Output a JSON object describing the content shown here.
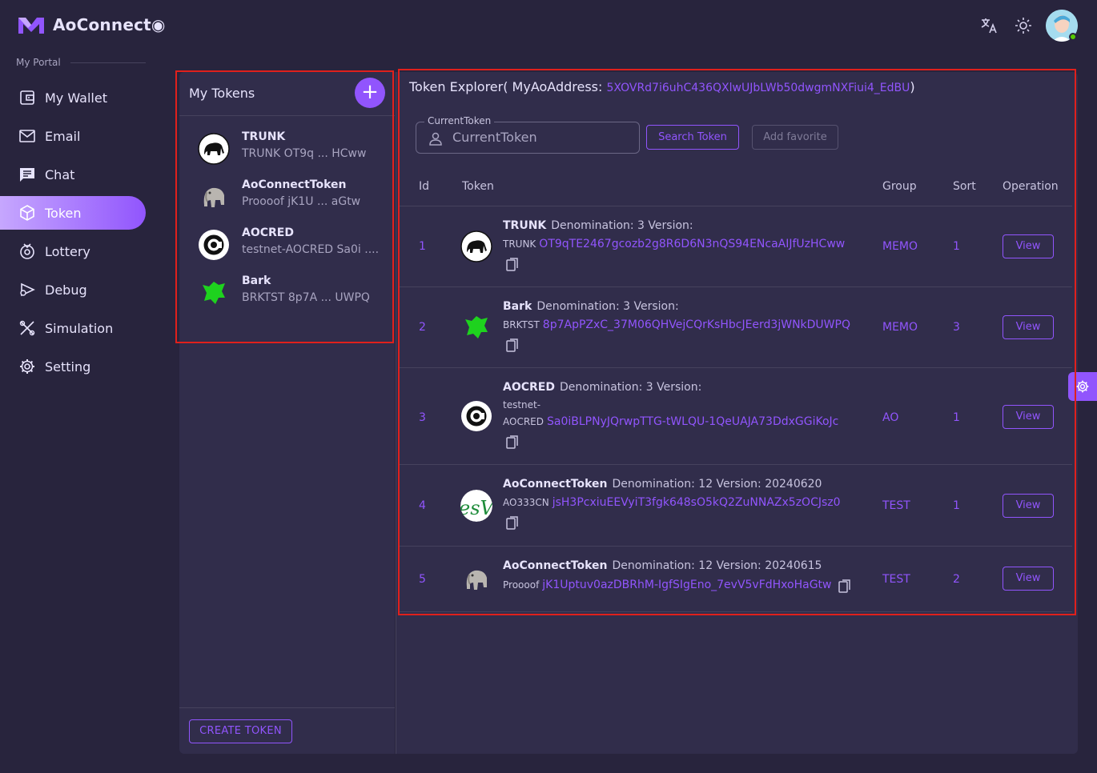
{
  "app": {
    "name": "AoConnect◉"
  },
  "sidebar": {
    "section_label": "My Portal",
    "items": [
      {
        "label": "My Wallet",
        "icon": "wallet-icon"
      },
      {
        "label": "Email",
        "icon": "email-icon"
      },
      {
        "label": "Chat",
        "icon": "chat-icon"
      },
      {
        "label": "Token",
        "icon": "token-icon",
        "active": true
      },
      {
        "label": "Lottery",
        "icon": "lottery-icon"
      },
      {
        "label": "Debug",
        "icon": "debug-icon"
      },
      {
        "label": "Simulation",
        "icon": "simulation-icon"
      },
      {
        "label": "Setting",
        "icon": "setting-icon"
      }
    ]
  },
  "my_tokens": {
    "title": "My Tokens",
    "add_label": "+",
    "items": [
      {
        "name": "TRUNK",
        "sub": "TRUNK OT9q ... HCww"
      },
      {
        "name": "AoConnectToken",
        "sub": "Proooof jK1U ... aGtw"
      },
      {
        "name": "AOCRED",
        "sub": "testnet-AOCRED Sa0i ...."
      },
      {
        "name": "Bark",
        "sub": "BRKTST 8p7A ... UWPQ"
      }
    ],
    "create_label": "CREATE TOKEN"
  },
  "explorer": {
    "title_prefix": "Token Explorer( MyAoAddress:",
    "address": "5XOVRd7i6uhC436QXlwUJbLWb50dwgmNXFiui4_EdBU",
    "title_suffix": ")",
    "field_label": "CurrentToken",
    "field_placeholder": "CurrentToken",
    "search_label": "Search Token",
    "favorite_label": "Add favorite",
    "columns": [
      "Id",
      "Token",
      "Group",
      "Sort",
      "Operation"
    ],
    "rows": [
      {
        "id": "1",
        "name": "TRUNK",
        "meta": "Denomination: 3  Version:",
        "ticker": "TRUNK",
        "process": "OT9qTE2467gcozb2g8R6D6N3nQS94ENcaAIJfUzHCww",
        "group": "MEMO",
        "sort": "1",
        "op": "View"
      },
      {
        "id": "2",
        "name": "Bark",
        "meta": "Denomination: 3  Version:",
        "ticker": "BRKTST",
        "process": "8p7ApPZxC_37M06QHVejCQrKsHbcJEerd3jWNkDUWPQ",
        "group": "MEMO",
        "sort": "3",
        "op": "View"
      },
      {
        "id": "3",
        "name": "AOCRED",
        "meta": "Denomination: 3  Version:",
        "ticker_a": "testnet-",
        "ticker": "AOCRED",
        "process": "Sa0iBLPNyJQrwpTTG-tWLQU-1QeUAJA73DdxGGiKoJc",
        "group": "AO",
        "sort": "1",
        "op": "View"
      },
      {
        "id": "4",
        "name": "AoConnectToken",
        "meta": "Denomination: 12  Version: 20240620",
        "ticker": "AO333CN",
        "process": "jsH3PcxiuEEVyiT3fgk648sO5kQ2ZuNNAZx5zOCJsz0",
        "group": "TEST",
        "sort": "1",
        "op": "View"
      },
      {
        "id": "5",
        "name": "AoConnectToken",
        "meta": "Denomination: 12  Version: 20240615",
        "ticker": "Proooof",
        "process": "jK1Uptuv0azDBRhM-IgfSIgEno_7evV5vFdHxoHaGtw",
        "group": "TEST",
        "sort": "2",
        "op": "View"
      }
    ]
  },
  "colors": {
    "accent": "#9155fd",
    "background": "#28243d",
    "panel": "#312d4b",
    "highlight": "#e0201c"
  }
}
